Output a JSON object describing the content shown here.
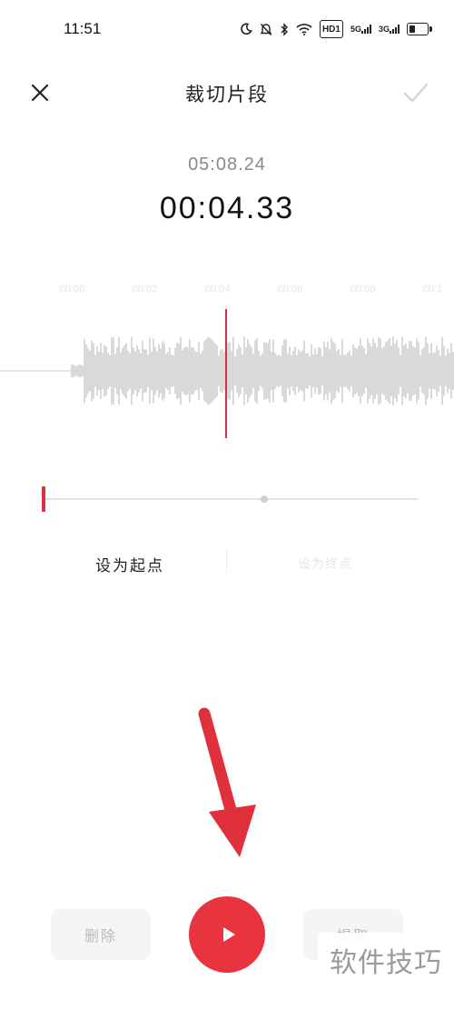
{
  "status_bar": {
    "time": "11:51",
    "hd_badge": "HD1",
    "net1": "5G",
    "net2": "3G"
  },
  "header": {
    "title": "裁切片段",
    "close_icon": "close-icon",
    "confirm_icon": "checkmark-icon"
  },
  "times": {
    "total": "05:08.24",
    "current": "00:04.33"
  },
  "ruler": {
    "ticks": [
      "00:00",
      "00:02",
      "00:04",
      "00:06",
      "00:08",
      "00:1"
    ]
  },
  "actions": {
    "set_start": "设为起点",
    "set_end": "设为终点"
  },
  "controls": {
    "delete": "删除",
    "extract": "提取",
    "play_icon": "play-icon"
  },
  "watermark": "软件技巧",
  "colors": {
    "accent": "#e8343f",
    "waveform": "#d9d9d9",
    "arrow": "#e0303c"
  }
}
